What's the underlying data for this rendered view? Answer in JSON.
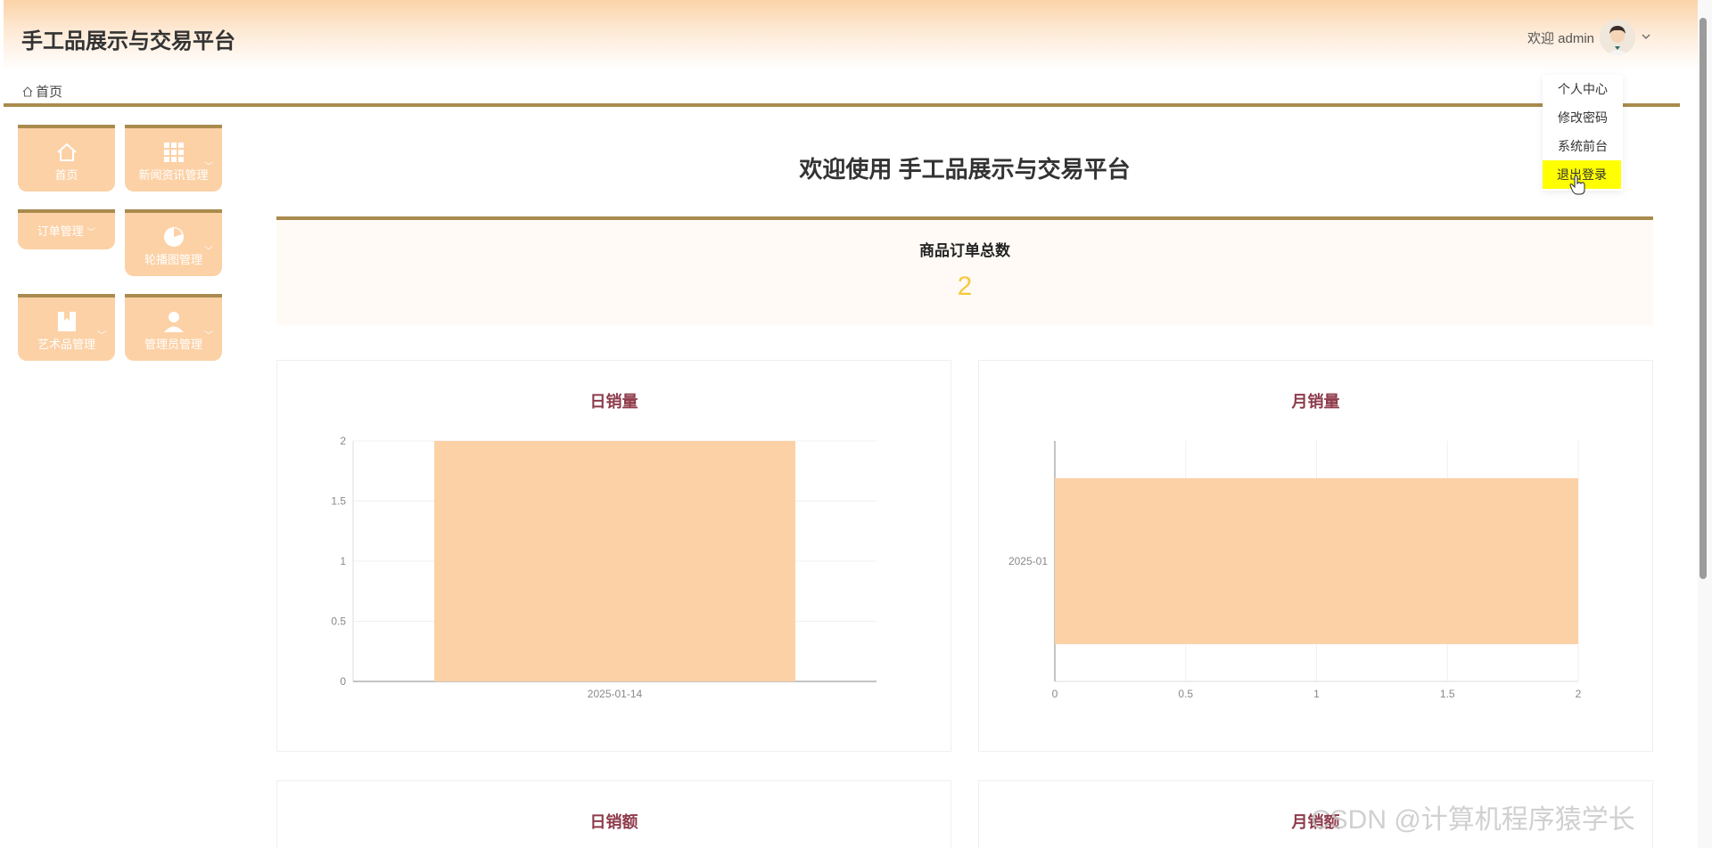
{
  "header": {
    "app_title": "手工品展示与交易平台",
    "welcome": "欢迎 admin"
  },
  "breadcrumb": {
    "home": "首页"
  },
  "user_menu": {
    "items": [
      "个人中心",
      "修改密码",
      "系统前台",
      "退出登录"
    ],
    "highlighted": "退出登录",
    "highlight_color": "#ffff00"
  },
  "sidebar": {
    "tiles": [
      {
        "label": "首页",
        "icon": "home-icon"
      },
      {
        "label": "新闻资讯管理",
        "icon": "grid-icon"
      },
      {
        "label": "订单管理",
        "icon": ""
      },
      {
        "label": "轮播图管理",
        "icon": "pie-icon"
      },
      {
        "label": "艺术品管理",
        "icon": "bookmark-icon"
      },
      {
        "label": "管理员管理",
        "icon": "user-icon"
      }
    ]
  },
  "main": {
    "welcome_title": "欢迎使用 手工品展示与交易平台",
    "stat": {
      "label": "商品订单总数",
      "value": "2"
    },
    "panels": {
      "daily_sales": "日销量",
      "monthly_sales": "月销量",
      "daily_amount": "日销额",
      "monthly_amount": "月销额"
    }
  },
  "chart_data": [
    {
      "type": "bar",
      "title": "日销量",
      "orientation": "vertical",
      "categories": [
        "2025-01-14"
      ],
      "values": [
        2
      ],
      "ylim": [
        0,
        2
      ],
      "yticks": [
        "0",
        "0.5",
        "1",
        "1.5",
        "2"
      ],
      "color": "#fcd1a6"
    },
    {
      "type": "bar",
      "title": "月销量",
      "orientation": "horizontal",
      "categories": [
        "2025-01"
      ],
      "values": [
        2
      ],
      "xlim": [
        0,
        2
      ],
      "xticks": [
        "0",
        "0.5",
        "1",
        "1.5",
        "2"
      ],
      "color": "#fcd1a6"
    }
  ],
  "watermark": "CSDN @计算机程序猿学长",
  "colors": {
    "accent": "#a98b4e",
    "tile": "#fcd1a6",
    "title": "#8e3b4b",
    "stat": "#f7c93a"
  }
}
